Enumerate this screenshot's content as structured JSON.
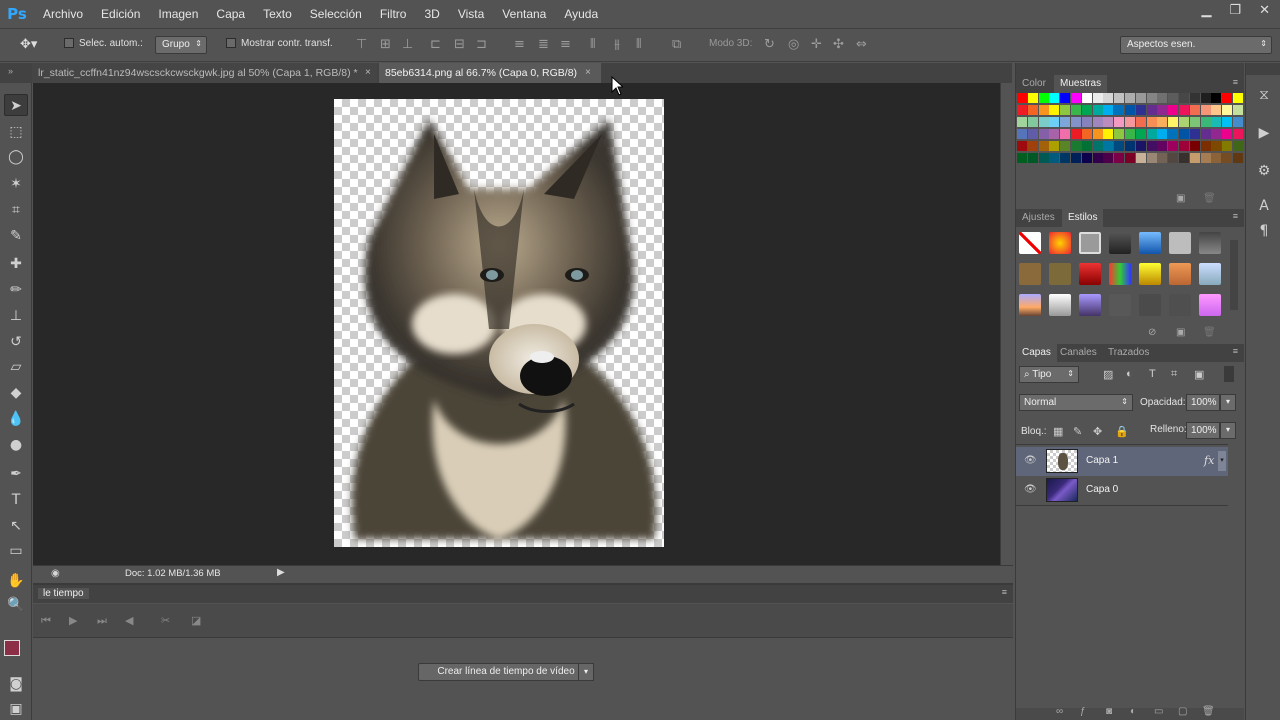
{
  "app": {
    "logo": "Ps"
  },
  "menu": [
    "Archivo",
    "Edición",
    "Imagen",
    "Capa",
    "Texto",
    "Selección",
    "Filtro",
    "3D",
    "Vista",
    "Ventana",
    "Ayuda"
  ],
  "window_controls": [
    "▁",
    "❐",
    "✕"
  ],
  "options": {
    "auto_select_label": "Selec. autom.:",
    "auto_select_value": "Grupo",
    "show_transform_label": "Mostrar contr. transf.",
    "mode3d_label": "Modo 3D:",
    "workspace": "Aspectos esen."
  },
  "tabs": [
    {
      "label": "lr_static_ccffn41nz94wscsckcwsckgwk.jpg al 50% (Capa 1, RGB/8) *",
      "close": "×"
    },
    {
      "label": "85eb6314.png al 66.7% (Capa 0, RGB/8)",
      "close": "×"
    }
  ],
  "status": {
    "doc": "Doc: 1.02 MB/1.36 MB"
  },
  "timeline": {
    "title": "le tiempo",
    "create_button": "Crear línea de tiempo de vídeo"
  },
  "panels": {
    "color_tabs": [
      "Color",
      "Muestras"
    ],
    "adjust_tabs": [
      "Ajustes",
      "Estilos"
    ],
    "layers_tabs": [
      "Capas",
      "Canales",
      "Trazados"
    ]
  },
  "layers": {
    "filter_kind": "Tipo",
    "blend_mode": "Normal",
    "opacity_label": "Opacidad:",
    "opacity_value": "100%",
    "lock_label": "Bloq.:",
    "fill_label": "Relleno:",
    "fill_value": "100%",
    "fx_label": "fx",
    "items": [
      {
        "name": "Capa 1",
        "selected": true
      },
      {
        "name": "Capa 0",
        "selected": false
      }
    ]
  },
  "colors": {
    "foreground": "#8c2e46",
    "background": "#ffffff",
    "accent": "#31a8ff"
  }
}
